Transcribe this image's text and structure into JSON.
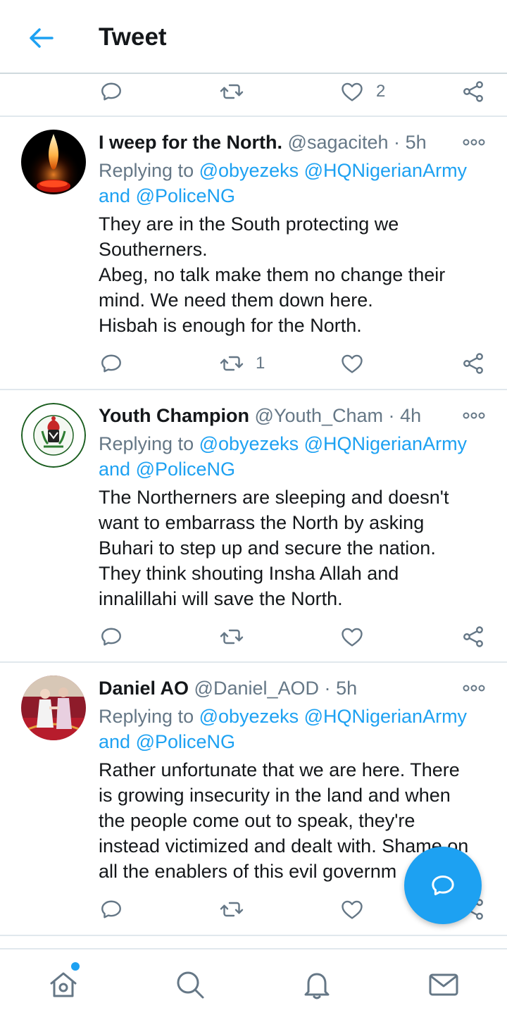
{
  "header": {
    "title": "Tweet"
  },
  "top_actions": {
    "like_count": "2"
  },
  "tweets": [
    {
      "name": "I weep for the North.",
      "handle": "@sagaciteh",
      "sep": "·",
      "time": "5h",
      "replying_prefix": "Replying to",
      "mention1": "@obyezeks",
      "mention2": "@HQNigerianArmy",
      "and": "and",
      "mention3": "@PoliceNG",
      "body": [
        "They are in the South protecting we",
        "Southerners.",
        "Abeg, no talk make them no change their",
        "mind. We need them down here.",
        "Hisbah is enough for the North."
      ],
      "retweet_count": "1",
      "like_count": ""
    },
    {
      "name": "Youth Champion",
      "handle": "@Youth_Cham",
      "sep": "·",
      "time": "4h",
      "replying_prefix": "Replying to",
      "mention1": "@obyezeks",
      "mention2": "@HQNigerianArmy",
      "and": "and",
      "mention3": "@PoliceNG",
      "body": [
        "The Northerners are sleeping and doesn't",
        "want to embarrass the North by asking",
        "Buhari to step up and secure the nation.",
        "They think shouting Insha Allah and",
        "innalillahi will save the North."
      ],
      "retweet_count": "",
      "like_count": ""
    },
    {
      "name": "Daniel AO",
      "handle": "@Daniel_AOD",
      "sep": "·",
      "time": "5h",
      "replying_prefix": "Replying to",
      "mention1": "@obyezeks",
      "mention2": "@HQNigerianArmy",
      "and": "and",
      "mention3": "@PoliceNG",
      "body": [
        "Rather unfortunate that we are here. There",
        "is growing insecurity in the land and when",
        "the people come out to speak, they're",
        "instead victimized and dealt with. Shame on",
        "all the enablers of this evil governm"
      ],
      "retweet_count": "",
      "like_count": ""
    }
  ],
  "avatar2_seal": {
    "top": "OFFICE OF THE CITIZEN",
    "right": "FEDERAL",
    "bottom": "REPUBLIC OF NIGERIA"
  },
  "colors": {
    "accent": "#1da1f2",
    "text": "#14171a",
    "muted": "#657786",
    "divider": "#e1e8ed"
  },
  "icons": [
    "back-arrow-icon",
    "reply-icon",
    "retweet-icon",
    "like-icon",
    "share-icon",
    "more-icon",
    "compose-reply-icon",
    "home-icon",
    "search-icon",
    "bell-icon",
    "mail-icon"
  ]
}
